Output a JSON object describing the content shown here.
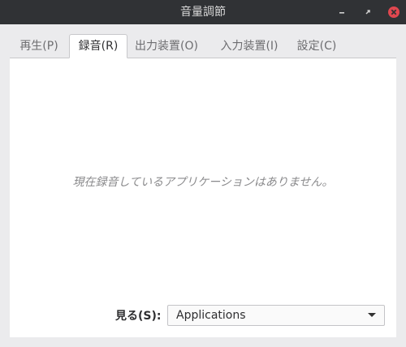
{
  "window": {
    "title": "音量調節",
    "controls": {
      "minimize_icon": "minimize-icon",
      "maximize_icon": "maximize-icon",
      "close_icon": "close-icon",
      "close_color": "#e0474f"
    }
  },
  "tabs": [
    {
      "label": "再生(P)",
      "active": false
    },
    {
      "label": "録音(R)",
      "active": true
    },
    {
      "label": "出力装置(O)",
      "active": false
    },
    {
      "label": "入力装置(I)",
      "active": false
    },
    {
      "label": "設定(C)",
      "active": false
    }
  ],
  "content": {
    "empty_message": "現在録音しているアプリケーションはありません。",
    "show_label": "見る(S):",
    "show_select": {
      "value": "Applications"
    }
  }
}
